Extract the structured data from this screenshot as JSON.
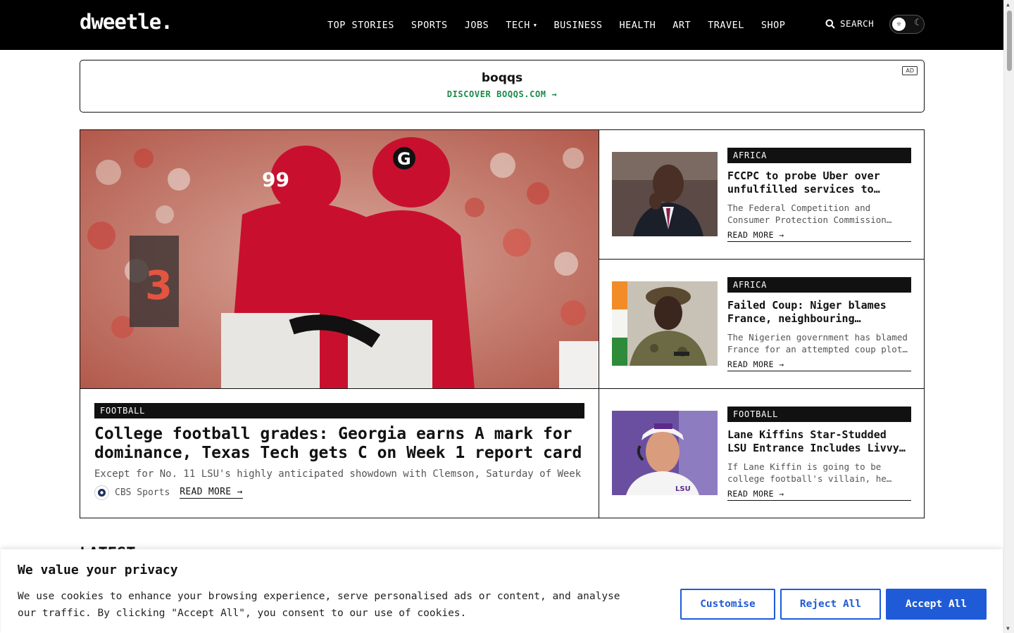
{
  "header": {
    "logo": "dweetle.",
    "nav": [
      {
        "label": "TOP STORIES"
      },
      {
        "label": "SPORTS"
      },
      {
        "label": "JOBS"
      },
      {
        "label": "TECH",
        "has_dropdown": true
      },
      {
        "label": "BUSINESS"
      },
      {
        "label": "HEALTH"
      },
      {
        "label": "ART"
      },
      {
        "label": "TRAVEL"
      },
      {
        "label": "SHOP"
      }
    ],
    "search_label": "SEARCH",
    "theme_toggle": {
      "state": "light"
    }
  },
  "ad": {
    "brand": "boqqs",
    "cta": "DISCOVER BOQQS.COM →",
    "tag": "AD",
    "cta_color": "#1a8a4a"
  },
  "hero": {
    "category": "FOOTBALL",
    "title": "College football grades: Georgia earns A mark for dominance, Texas Tech gets C on Week 1 report card",
    "excerpt": "Except for No. 11 LSU's highly anticipated showdown with Clemson, Saturday of Week",
    "source": "CBS Sports",
    "read_more": "READ MORE →"
  },
  "side_articles": [
    {
      "category": "AFRICA",
      "title_lines": [
        "FCCPC to probe Uber over",
        "unfulfilled services to…"
      ],
      "excerpt_lines": [
        "The Federal Competition and",
        "Consumer Protection Commission…"
      ],
      "read_more": "READ MORE →"
    },
    {
      "category": "AFRICA",
      "title_lines": [
        "Failed Coup: Niger blames",
        "France, neighbouring…"
      ],
      "excerpt_lines": [
        "The Nigerien government has blamed",
        "France for an attempted coup plot…"
      ],
      "read_more": "READ MORE →"
    },
    {
      "category": "FOOTBALL",
      "title_lines": [
        "Lane Kiffins Star-Studded",
        "LSU Entrance Includes Livvy…"
      ],
      "excerpt_lines": [
        "If Lane Kiffin is going to be",
        "college football's villain, he…"
      ],
      "read_more": "READ MORE →"
    }
  ],
  "section_heading": "LATEST",
  "cookie": {
    "title": "We value your privacy",
    "text": "We use cookies to enhance your browsing experience, serve personalised ads or content, and analyse our traffic. By clicking \"Accept All\", you consent to our use of cookies.",
    "customise_label": "Customise",
    "reject_label": "Reject All",
    "accept_label": "Accept All",
    "accent_color": "#1f5bd6"
  }
}
